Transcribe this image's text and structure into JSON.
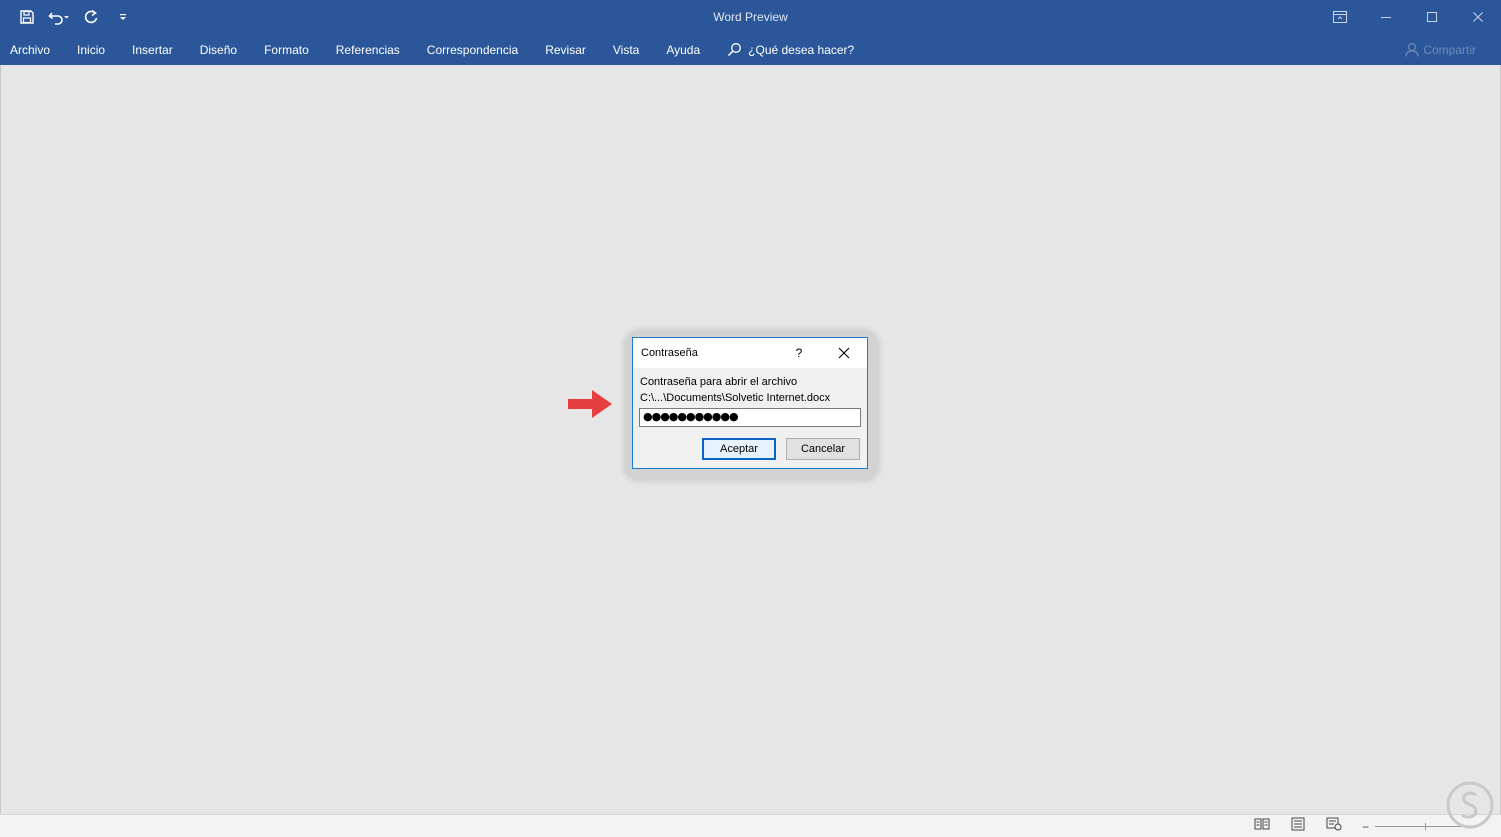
{
  "window": {
    "title": "Word Preview"
  },
  "quick_access": {
    "save_icon": "save-icon",
    "undo_icon": "undo-icon",
    "redo_icon": "redo-icon",
    "customize_icon": "customize-qat-icon"
  },
  "ribbon": {
    "tabs": [
      "Archivo",
      "Inicio",
      "Insertar",
      "Diseño",
      "Formato",
      "Referencias",
      "Correspondencia",
      "Revisar",
      "Vista",
      "Ayuda"
    ],
    "tell_me": "¿Qué desea hacer?",
    "share": "Compartir"
  },
  "dialog": {
    "title": "Contraseña",
    "help": "?",
    "label": "Contraseña para abrir el archivo",
    "path": "C:\\...\\Documents\\Solvetic Internet.docx",
    "password_value": "●●●●●●●●●●●",
    "ok": "Aceptar",
    "cancel": "Cancelar"
  },
  "colors": {
    "ribbon": "#2b579a",
    "workspace": "#e6e6e6",
    "dialog_border": "#1e7bd4",
    "arrow": "#e53f3f"
  }
}
